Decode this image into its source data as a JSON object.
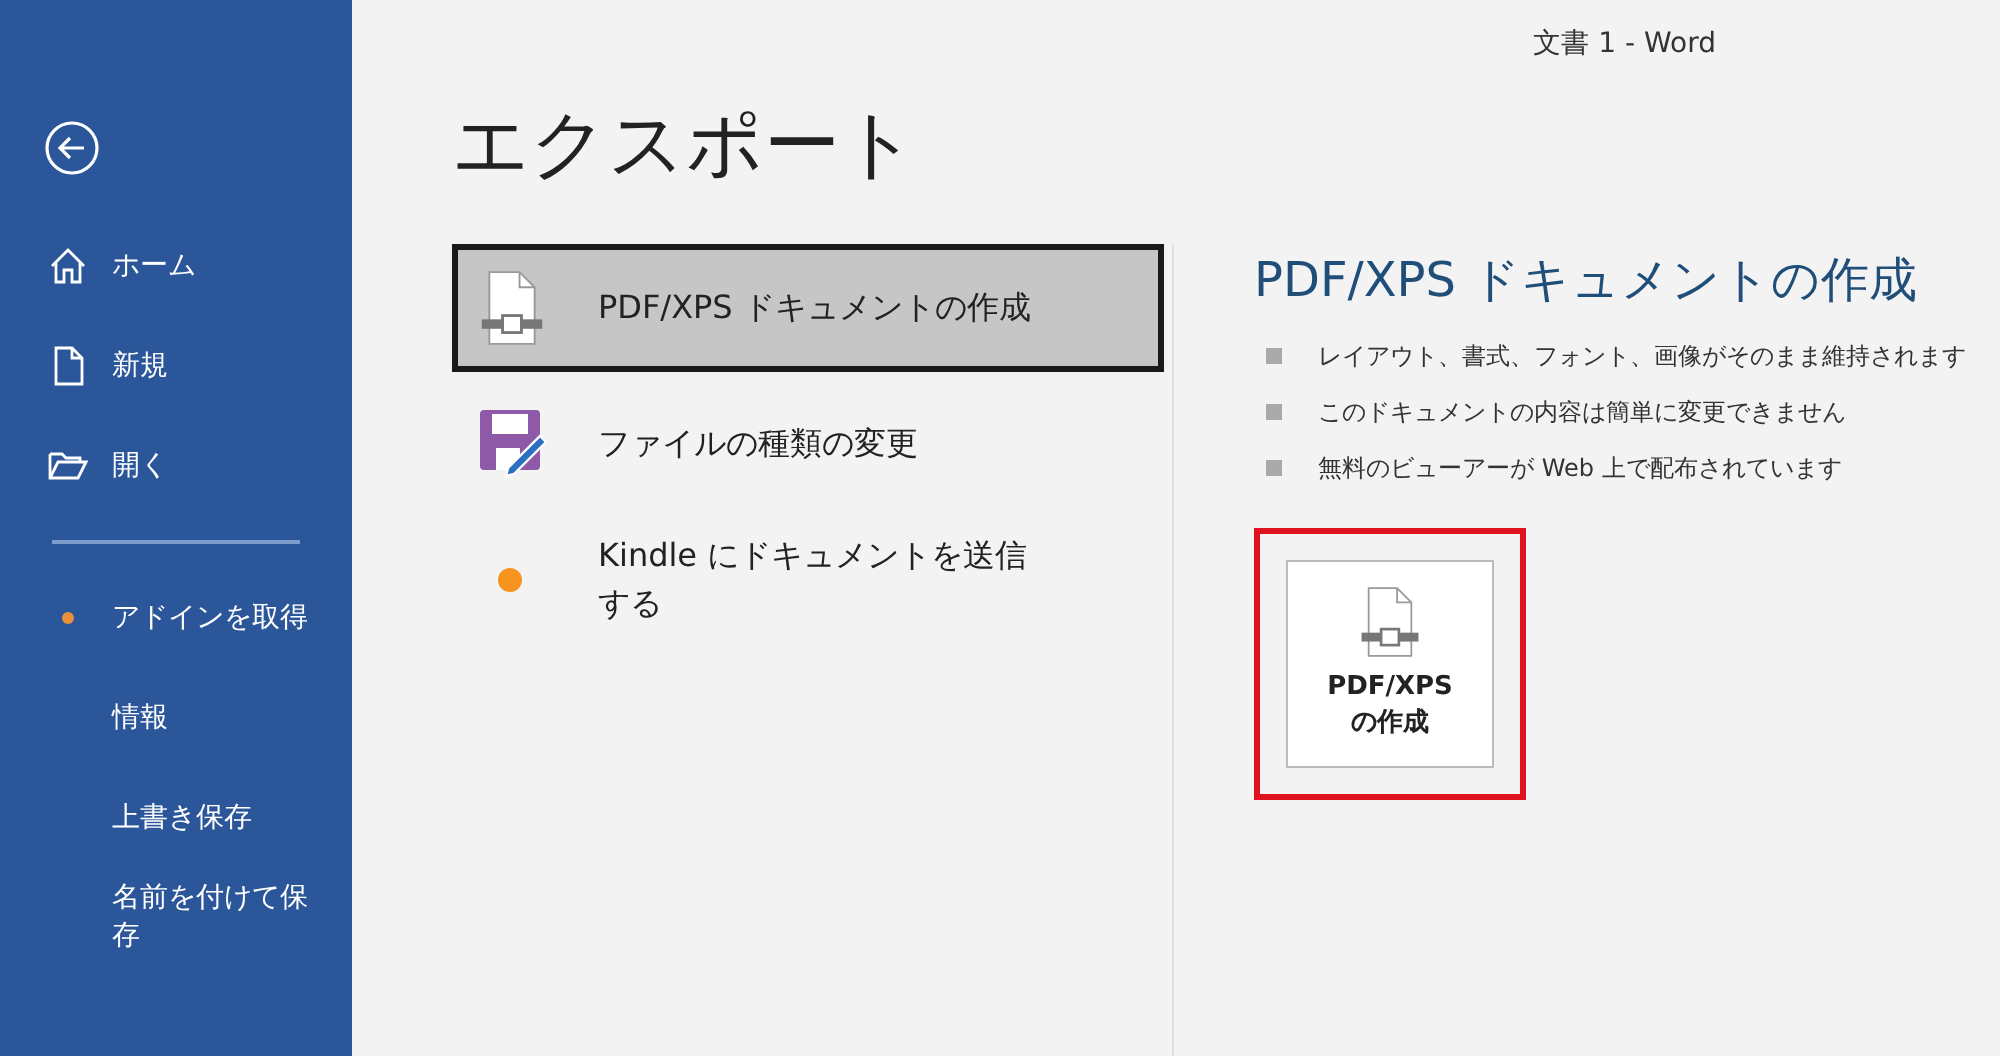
{
  "window": {
    "title": "文書 1  -  Word"
  },
  "sidebar": {
    "items": [
      {
        "label": "ホーム",
        "kind": "home",
        "badge": false
      },
      {
        "label": "新規",
        "kind": "new",
        "badge": false
      },
      {
        "label": "開く",
        "kind": "open",
        "badge": false
      },
      {
        "label": "アドインを取得",
        "kind": "plain",
        "badge": true
      },
      {
        "label": "情報",
        "kind": "plain",
        "badge": false
      },
      {
        "label": "上書き保存",
        "kind": "plain",
        "badge": false
      },
      {
        "label": "名前を付けて保存",
        "kind": "plain",
        "badge": false
      }
    ]
  },
  "page_title": "エクスポート",
  "options": [
    {
      "label": "PDF/XPS ドキュメントの作成",
      "kind": "pdf",
      "selected": true
    },
    {
      "label": "ファイルの種類の変更",
      "kind": "filetype",
      "selected": false
    },
    {
      "label": "Kindle にドキュメントを送信する",
      "kind": "kindle",
      "selected": false
    }
  ],
  "detail": {
    "heading": "PDF/XPS ドキュメントの作成",
    "bullets": [
      "レイアウト、書式、フォント、画像がそのまま維持されます",
      "このドキュメントの内容は簡単に変更できません",
      "無料のビューアーが Web 上で配布されています"
    ],
    "button": {
      "label": "PDF/XPS\nの作成",
      "highlighted": true
    }
  }
}
